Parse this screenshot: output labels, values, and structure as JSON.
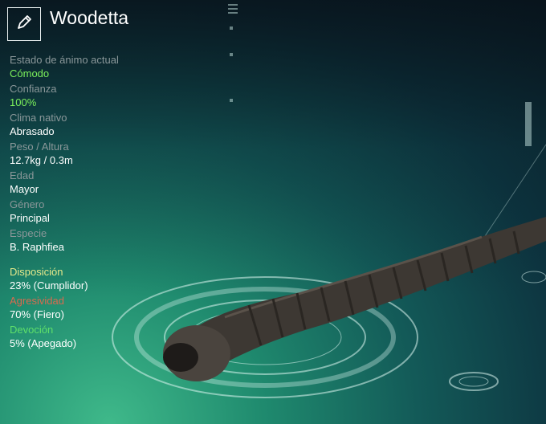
{
  "creature": {
    "name": "Woodetta",
    "edit_icon": "pencil-icon"
  },
  "stats": [
    {
      "label": "Estado de ánimo actual",
      "value": "Cómodo",
      "highlight": true
    },
    {
      "label": "Confianza",
      "value": "100%",
      "highlight": true
    },
    {
      "label": "Clima nativo",
      "value": "Abrasado",
      "highlight": false
    },
    {
      "label": "Peso / Altura",
      "value": "12.7kg / 0.3m",
      "highlight": false
    },
    {
      "label": "Edad",
      "value": "Mayor",
      "highlight": false
    },
    {
      "label": "Género",
      "value": "Principal",
      "highlight": false
    },
    {
      "label": "Especie",
      "value": "B. Raphfiea",
      "highlight": false
    }
  ],
  "traits": [
    {
      "label": "Disposición",
      "value": "23% (Cumplidor)",
      "color": "#e4e88a"
    },
    {
      "label": "Agresividad",
      "value": "70% (Fiero)",
      "color": "#d86a4f"
    },
    {
      "label": "Devoción",
      "value": "5% (Apegado)",
      "color": "#5fe06a"
    }
  ],
  "colors": {
    "highlight_value": "#7cf05c",
    "label_gray": "#8a9799"
  }
}
